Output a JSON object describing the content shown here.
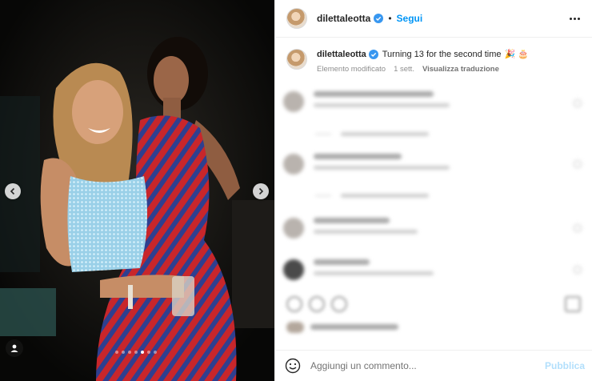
{
  "header": {
    "username": "dilettaleotta",
    "separator": "•",
    "follow_label": "Segui",
    "more_icon": "more-horizontal-icon"
  },
  "caption": {
    "username": "dilettaleotta",
    "text": "Turning 13 for the second time",
    "emojis": "🎉 🎂",
    "edited_label": "Elemento modificato",
    "time": "1 sett.",
    "translate_label": "Visualizza traduzione"
  },
  "media": {
    "slide_count": 7,
    "active_slide": 5
  },
  "comment_box": {
    "placeholder": "Aggiungi un commento...",
    "publish_label": "Pubblica"
  },
  "colors": {
    "accent": "#0095f6",
    "publish_disabled": "#b2dffc",
    "verified": "#3897f0"
  }
}
